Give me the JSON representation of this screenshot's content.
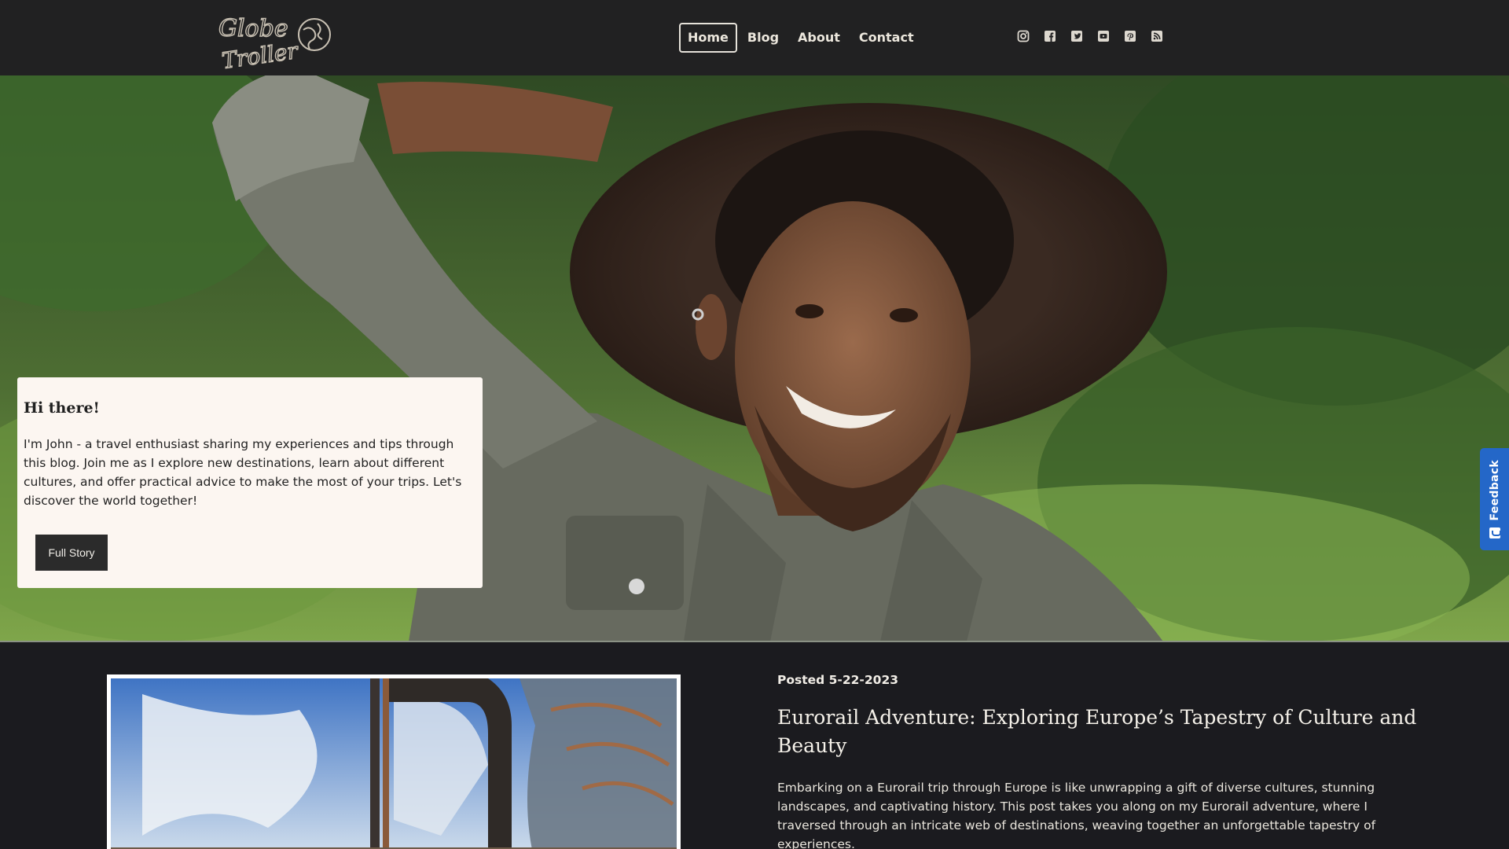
{
  "brand": {
    "logo_text_line1": "Globe",
    "logo_text_line2": "Troller"
  },
  "nav": {
    "items": [
      {
        "label": "Home",
        "active": true
      },
      {
        "label": "Blog",
        "active": false
      },
      {
        "label": "About",
        "active": false
      },
      {
        "label": "Contact",
        "active": false
      }
    ]
  },
  "socials": [
    "instagram-icon",
    "facebook-icon",
    "twitter-icon",
    "youtube-icon",
    "pinterest-icon",
    "rss-icon"
  ],
  "hero": {
    "card": {
      "heading": "Hi there!",
      "body": "I'm John - a travel enthusiast sharing my experiences and tips through this blog. Join me as I explore new destinations, learn about different cultures, and offer practical advice to make the most of your trips. Let's discover the world together!",
      "button_label": "Full Story"
    }
  },
  "feedback": {
    "label": "Feedback"
  },
  "post": {
    "posted": "Posted 5-22-2023",
    "title": "Eurorail Adventure: Exploring Europe’s Tapestry of Culture and Beauty",
    "excerpt": "Embarking on a Eurorail trip through Europe is like unwrapping a gift of diverse cultures, stunning landscapes, and captivating history. This post takes you along on my Eurorail adventure, where I traversed through an intricate web of destinations, weaving together an unforgettable tapestry of experiences."
  },
  "colors": {
    "header_bg": "#212122",
    "page_bg": "#1b1b1f",
    "card_bg": "#fcf6f1",
    "button_bg": "#2b2b2b",
    "feedback_bg": "#2467c8"
  }
}
